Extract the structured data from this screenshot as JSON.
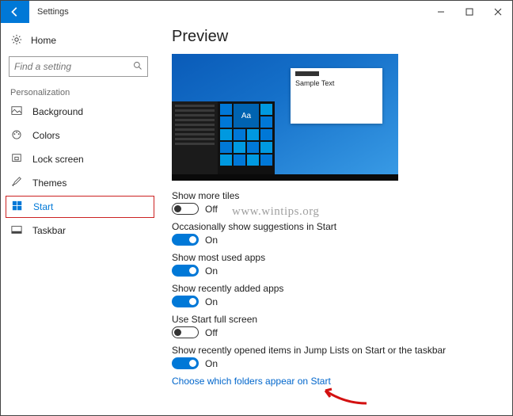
{
  "titlebar": {
    "title": "Settings"
  },
  "sidebar": {
    "home_label": "Home",
    "search_placeholder": "Find a setting",
    "section_label": "Personalization",
    "items": [
      {
        "label": "Background",
        "icon": "image"
      },
      {
        "label": "Colors",
        "icon": "palette"
      },
      {
        "label": "Lock screen",
        "icon": "lock"
      },
      {
        "label": "Themes",
        "icon": "brush"
      },
      {
        "label": "Start",
        "icon": "start",
        "selected": true
      },
      {
        "label": "Taskbar",
        "icon": "taskbar"
      }
    ]
  },
  "content": {
    "heading": "Preview",
    "preview": {
      "sample_text": "Sample Text",
      "aa": "Aa"
    },
    "settings": [
      {
        "label": "Show more tiles",
        "state": "Off",
        "on": false
      },
      {
        "label": "Occasionally show suggestions in Start",
        "state": "On",
        "on": true
      },
      {
        "label": "Show most used apps",
        "state": "On",
        "on": true
      },
      {
        "label": "Show recently added apps",
        "state": "On",
        "on": true
      },
      {
        "label": "Use Start full screen",
        "state": "Off",
        "on": false
      },
      {
        "label": "Show recently opened items in Jump Lists on Start or the taskbar",
        "state": "On",
        "on": true
      }
    ],
    "link": "Choose which folders appear on Start"
  },
  "watermark": "www.wintips.org"
}
